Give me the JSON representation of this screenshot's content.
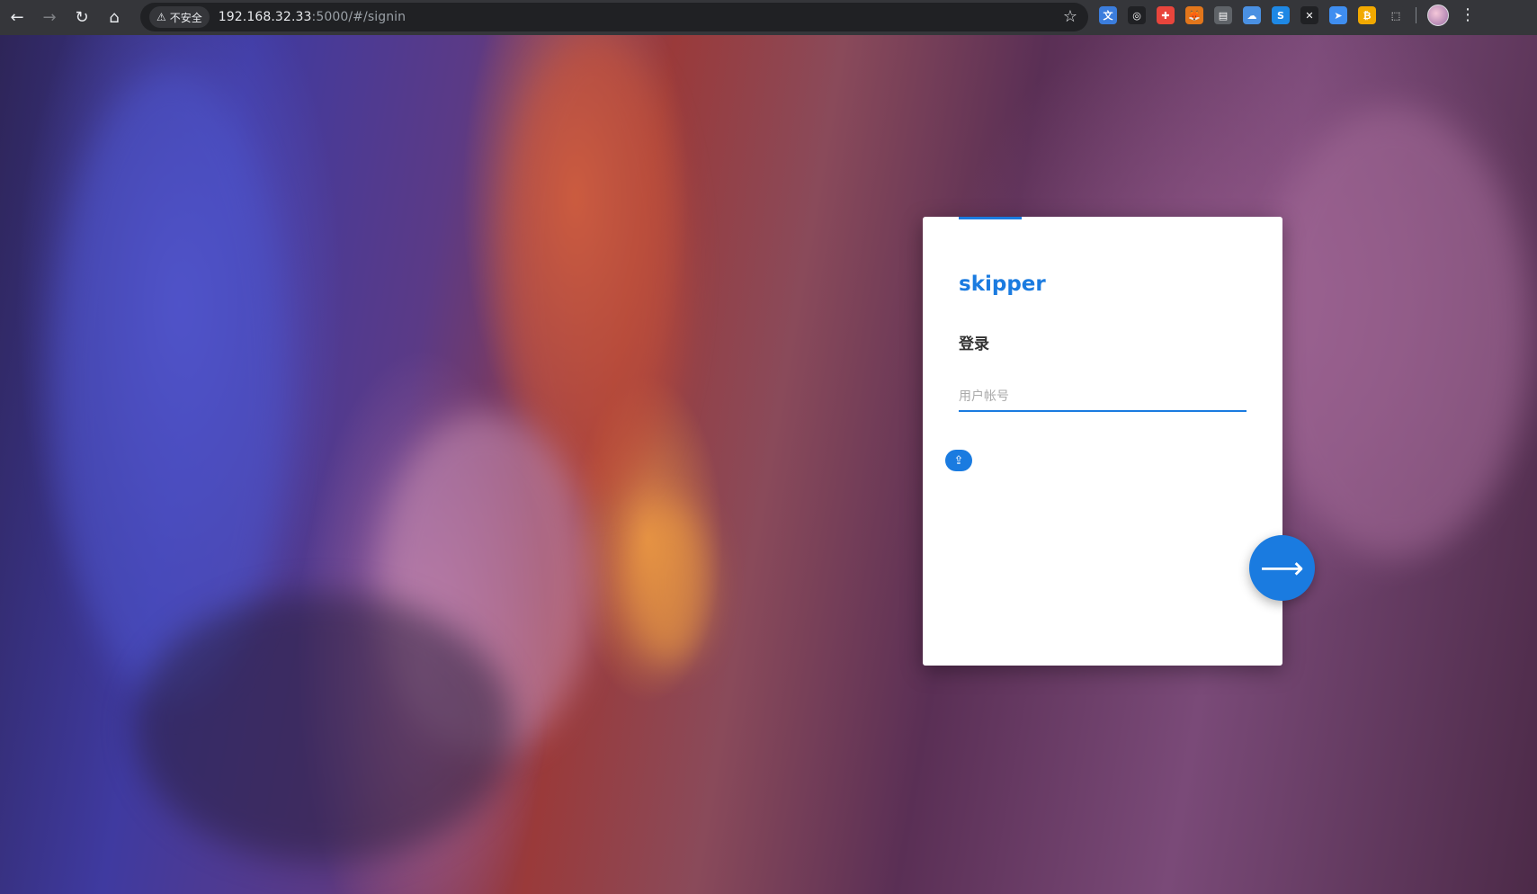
{
  "browser": {
    "security_label": "不安全",
    "url_host": "192.168.32.33",
    "url_path": ":5000/#/signin",
    "extensions": [
      {
        "name": "translate-ext-icon",
        "color": "#3b7ddd",
        "glyph": "文"
      },
      {
        "name": "mask-ext-icon",
        "color": "#202124",
        "glyph": "◎"
      },
      {
        "name": "red-ext-icon",
        "color": "#e8453c",
        "glyph": "✚"
      },
      {
        "name": "fox-ext-icon",
        "color": "#e2761b",
        "glyph": "🦊"
      },
      {
        "name": "card-ext-icon",
        "color": "#5f6368",
        "glyph": "▤"
      },
      {
        "name": "cloud-ext-icon",
        "color": "#4a90e2",
        "glyph": "☁"
      },
      {
        "name": "s-ext-icon",
        "color": "#1e88e5",
        "glyph": "S"
      },
      {
        "name": "x-ext-icon",
        "color": "#202124",
        "glyph": "✕"
      },
      {
        "name": "compass-ext-icon",
        "color": "#3f8ef0",
        "glyph": "➤"
      },
      {
        "name": "coin-ext-icon",
        "color": "#f2a900",
        "glyph": "₿"
      },
      {
        "name": "puzzle-ext-icon",
        "color": "#35363a",
        "glyph": "⬚"
      }
    ]
  },
  "login": {
    "brand": "skipper",
    "title": "登录",
    "username_placeholder": "用户帐号",
    "username_value": "",
    "accent_color": "#1a7be0"
  }
}
